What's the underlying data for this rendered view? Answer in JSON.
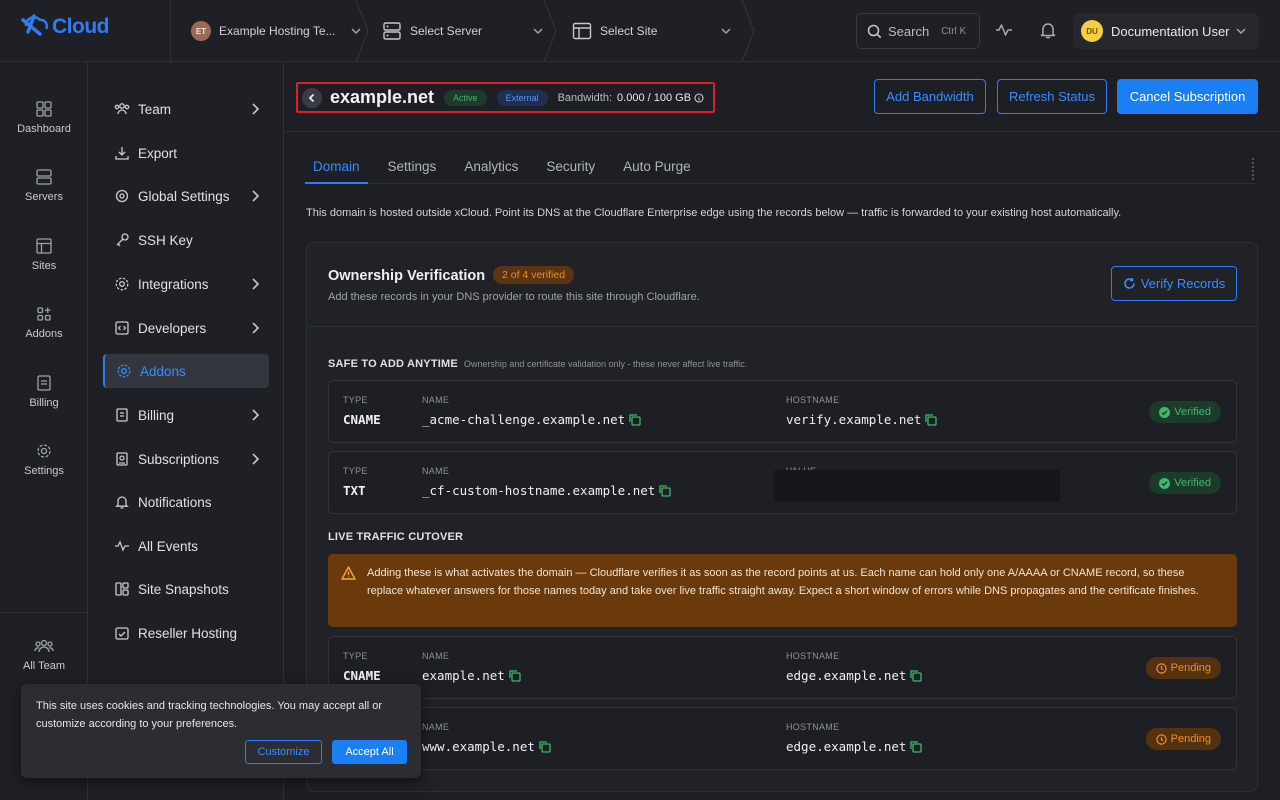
{
  "brand": {
    "name": "Cloud",
    "logo_icon": "xcloud-logo"
  },
  "header": {
    "team": {
      "initials": "ET",
      "name": "Example Hosting Te...",
      "avatar_color": "#9a6a58"
    },
    "server": {
      "label": "Select Server"
    },
    "site": {
      "label": "Select Site"
    },
    "search": {
      "label": "Search",
      "shortcut": "Ctrl K"
    },
    "user": {
      "initials": "DU",
      "name": "Documentation User",
      "avatar_color": "#f4d03f"
    }
  },
  "rail": {
    "items": [
      {
        "label": "Dashboard",
        "icon": "dashboard-icon"
      },
      {
        "label": "Servers",
        "icon": "servers-icon"
      },
      {
        "label": "Sites",
        "icon": "sites-icon"
      },
      {
        "label": "Addons",
        "icon": "addons-icon"
      },
      {
        "label": "Billing",
        "icon": "billing-icon"
      },
      {
        "label": "Settings",
        "icon": "settings-icon"
      }
    ],
    "bottom": {
      "label": "All Team",
      "icon": "team-icon"
    }
  },
  "subnav": {
    "items": [
      {
        "label": "Team",
        "icon": "team-icon",
        "has_children": true
      },
      {
        "label": "Export",
        "icon": "export-icon",
        "has_children": false
      },
      {
        "label": "Global Settings",
        "icon": "global-settings-icon",
        "has_children": true
      },
      {
        "label": "SSH Key",
        "icon": "key-icon",
        "has_children": false
      },
      {
        "label": "Integrations",
        "icon": "integrations-icon",
        "has_children": true
      },
      {
        "label": "Developers",
        "icon": "code-icon",
        "has_children": true
      },
      {
        "label": "Addons",
        "icon": "addons-icon",
        "has_children": false,
        "active": true
      },
      {
        "label": "Billing",
        "icon": "billing-icon",
        "has_children": true
      },
      {
        "label": "Subscriptions",
        "icon": "subscriptions-icon",
        "has_children": true
      },
      {
        "label": "Notifications",
        "icon": "bell-icon",
        "has_children": false
      },
      {
        "label": "All Events",
        "icon": "activity-icon",
        "has_children": false
      },
      {
        "label": "Site Snapshots",
        "icon": "snapshots-icon",
        "has_children": false
      },
      {
        "label": "Reseller Hosting",
        "icon": "reseller-icon",
        "has_children": false
      }
    ]
  },
  "page": {
    "site_name": "example.net",
    "status": "Active",
    "hosting": "External",
    "bandwidth_label": "Bandwidth:",
    "bandwidth_value": "0.000 / 100 GB",
    "actions": {
      "add_bandwidth": "Add Bandwidth",
      "refresh_status": "Refresh Status",
      "cancel_subscription": "Cancel Subscription"
    },
    "tabs": [
      {
        "label": "Domain",
        "active": true
      },
      {
        "label": "Settings"
      },
      {
        "label": "Analytics"
      },
      {
        "label": "Security"
      },
      {
        "label": "Auto Purge"
      }
    ],
    "intro": "This domain is hosted outside xCloud. Point its DNS at the Cloudflare Enterprise edge using the records below — traffic is forwarded to your existing host automatically."
  },
  "card": {
    "title": "Ownership Verification",
    "progress_badge": "2 of 4 verified",
    "subtitle": "Add these records in your DNS provider to route this site through Cloudflare.",
    "verify_button": "Verify Records",
    "safe_section": {
      "title": "SAFE TO ADD ANYTIME",
      "note": "Ownership and certificate validation only - these never affect live traffic."
    },
    "cutover_section": {
      "title": "LIVE TRAFFIC CUTOVER"
    },
    "warning": "Adding these is what activates the domain — Cloudflare verifies it as soon as the record points at us. Each name can hold only one A/AAAA or CNAME record, so these replace whatever answers for those names today and take over live traffic straight away. Expect a short window of errors while DNS propagates and the certificate finishes.",
    "labels": {
      "type": "TYPE",
      "name": "NAME",
      "hostname": "HOSTNAME",
      "value": "VALUE"
    },
    "records": [
      {
        "type": "CNAME",
        "name": "_acme-challenge.example.net",
        "hostname": "verify.example.net",
        "status": "Verified"
      },
      {
        "type": "TXT",
        "name": "_cf-custom-hostname.example.net",
        "value_redacted": true,
        "status": "Verified"
      },
      {
        "type": "CNAME",
        "name": "example.net",
        "hostname": "edge.example.net",
        "status": "Pending"
      },
      {
        "type": "",
        "name": "www.example.net",
        "hostname": "edge.example.net",
        "status": "Pending"
      }
    ]
  },
  "cookie": {
    "text": "This site uses cookies and tracking technologies. You may accept all or customize according to your preferences.",
    "customize": "Customize",
    "accept": "Accept All"
  },
  "colors": {
    "accent": "#2e7cf6",
    "success": "#3fb86b",
    "warning": "#f08c2b",
    "danger_outline": "#e11d2a"
  }
}
